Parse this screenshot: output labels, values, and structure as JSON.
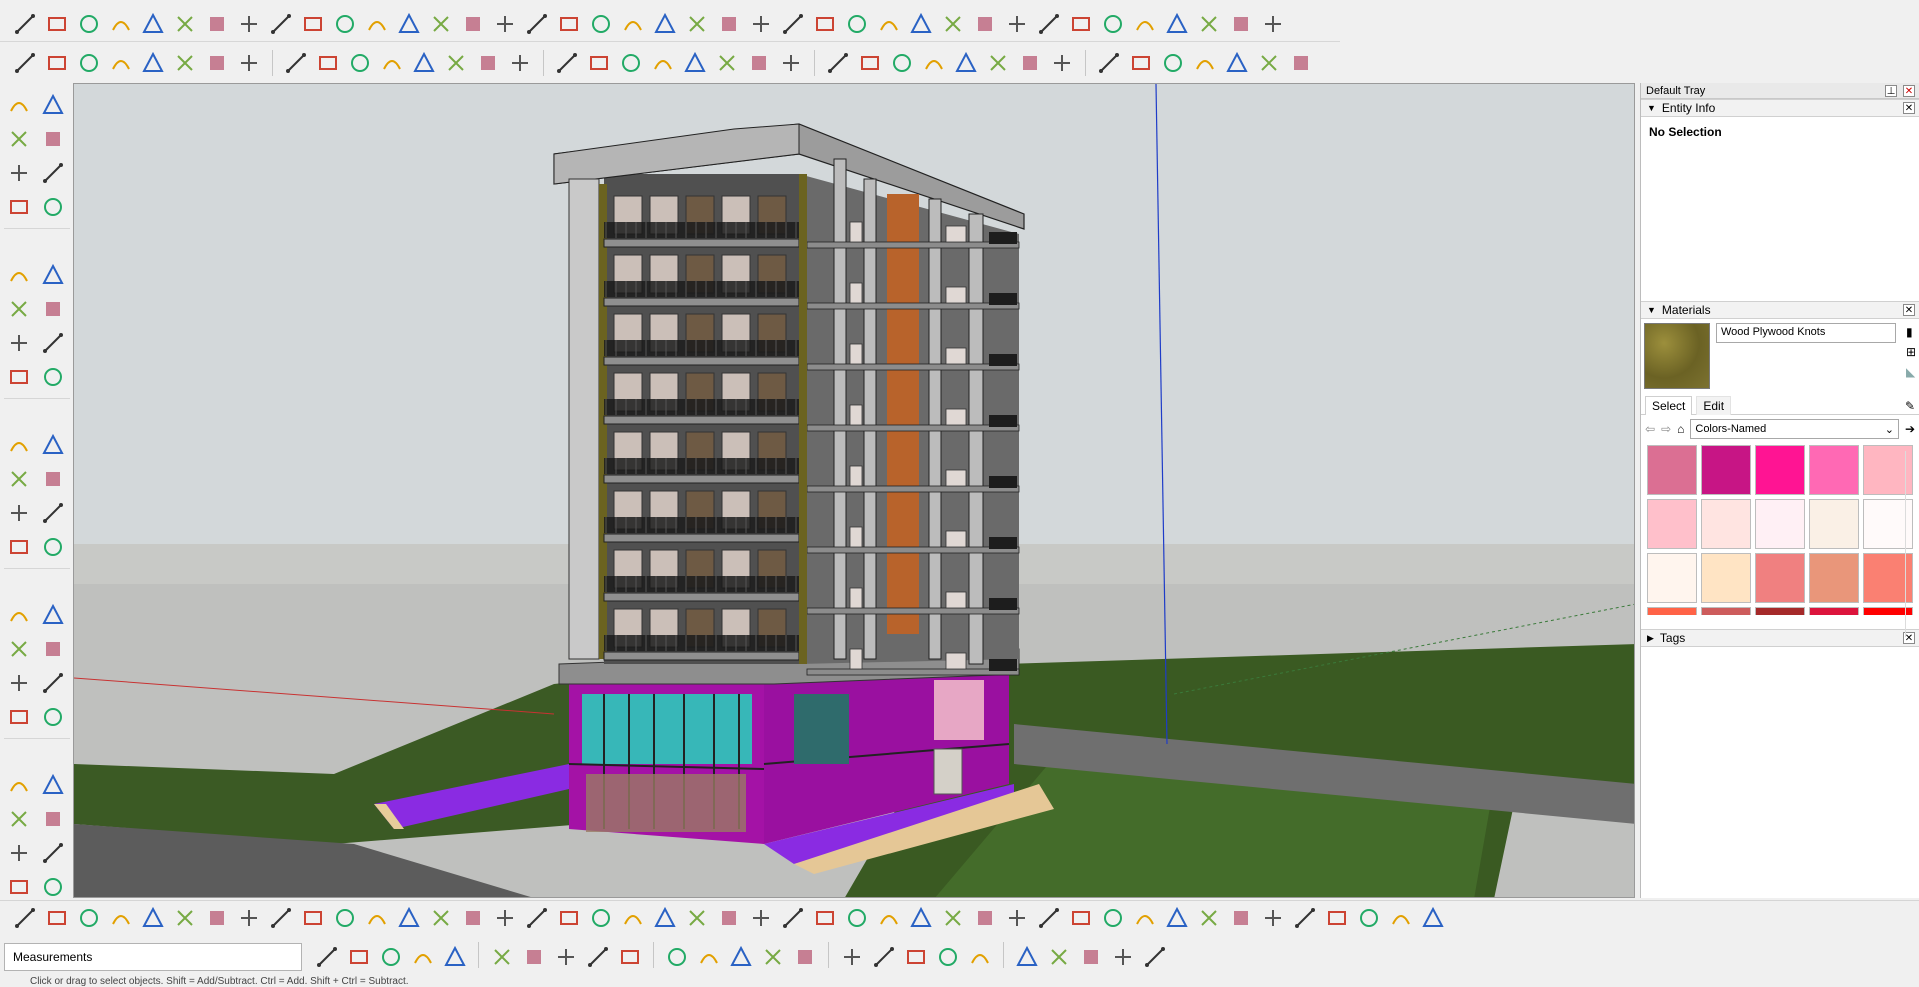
{
  "toolbar_top": {
    "icons": [
      "line-tool-icon",
      "arc-tool-icon",
      "paint-icon",
      "scissors-icon",
      "circle-tool-icon",
      "polygon-tool-icon",
      "sweep-icon",
      "extrude-icon",
      "sphere-icon",
      "lathe-icon",
      "bezier-icon",
      "fillet-icon",
      "chamfer-icon",
      "corner-icon",
      "offset-icon",
      "trim-icon",
      "stairs-icon",
      "railing-icon",
      "columns-icon",
      "grip-icon",
      "hand-icon",
      "leaf-icon",
      "fold-icon",
      "stacks-icon",
      "slope-icon",
      "truss-icon",
      "ramp-icon",
      "dome-icon",
      "pattern-icon",
      "pin-icon",
      "gate-icon",
      "window-grid-icon",
      "hatch-icon",
      "screen-icon",
      "fence-icon",
      "spiral-icon",
      "mesh-icon",
      "bevel-icon",
      "lattice-icon",
      "glass-icon"
    ]
  },
  "toolbar_second": {
    "icons": [
      "window-icon",
      "door-icon",
      "house-icon",
      "roof-icon",
      "garage-icon",
      "component-icon",
      "box-group-icon",
      "cube-icon",
      "stack-icon",
      "layer-stack-icon",
      "paste-icon",
      "door-frame-icon",
      "arch-window-icon",
      "ladder-icon",
      "blue-fill-icon",
      "diamond-icon",
      "roof-peak-icon",
      "hip-roof-icon",
      "flip-icon",
      "curve-icon",
      "angle-icon",
      "cross-icon",
      "fork-icon",
      "multi-line-icon",
      "tag-icon",
      "red-pencil-icon",
      "box-face-icon",
      "cylinder-icon",
      "hex-prism-icon",
      "round-solid-icon",
      "pentagon-solid-icon",
      "bend-icon",
      "red-sphere-icon",
      "yellow-cone-icon",
      "blue-cup-icon",
      "knot-icon",
      "red-arrow-icon",
      "eraser-icon",
      "hat-icon"
    ]
  },
  "left_tools": [
    "select-icon",
    "component-cube-icon",
    "paint-bucket-icon",
    "eraser-icon",
    "pencil-icon",
    "freehand-icon",
    "rectangle-icon",
    "rotated-rect-icon",
    "circle-icon",
    "polygon-icon",
    "arc-icon",
    "two-point-arc-icon",
    "three-point-arc-icon",
    "pie-icon",
    "move-icon",
    "push-pull-icon",
    "rotate-icon",
    "follow-me-icon",
    "scale-icon",
    "offset-icon",
    "tape-measure-icon",
    "dimension-icon",
    "protractor-icon",
    "text-icon",
    "axes-icon",
    "3d-text-icon",
    "orbit-icon",
    "pan-icon",
    "zoom-icon",
    "zoom-window-icon",
    "zoom-extents-icon",
    "previous-view-icon",
    "position-camera-icon",
    "look-around-icon",
    "walk-icon",
    "section-plane-icon",
    "sandbox-icon",
    "sandbox-scratch-icon",
    "sandbox-smoove-icon",
    "sandbox-stamp-icon"
  ],
  "tray": {
    "title": "Default Tray",
    "entity_info": {
      "title": "Entity Info",
      "status": "No Selection"
    },
    "materials": {
      "title": "Materials",
      "current_name": "Wood Plywood Knots",
      "tabs": [
        "Select",
        "Edit"
      ],
      "library": "Colors-Named",
      "swatches": [
        "#db6f93",
        "#c71585",
        "#ff1493",
        "#ff69b4",
        "#ffb6c1",
        "#ffc0cb",
        "#ffe4e1",
        "#fff0f5",
        "#faf0e6",
        "#fffafa",
        "#fff5ee",
        "#ffe4c4",
        "#f08080",
        "#e9967a",
        "#fa8072",
        "#ff6347",
        "#cd5c5c",
        "#a52a2a",
        "#dc143c",
        "#ff0000"
      ]
    },
    "tags": {
      "title": "Tags"
    }
  },
  "bottom_toolbar": {
    "icons": [
      "material-1-icon",
      "material-2-icon",
      "material-3-icon",
      "material-4-icon",
      "material-5-icon",
      "material-6-icon",
      "sync-icon",
      "camera-icon",
      "rotate-3d-icon",
      "orange-box-icon",
      "table-icon",
      "flag-icon",
      "cube-open-icon",
      "connector-icon",
      "bracket-icon",
      "node-line-icon",
      "node-curve-icon",
      "red-plus-icon",
      "green-plus-icon",
      "blue-cross-icon",
      "grid-dots-icon",
      "cone-icon",
      "cone-star-icon",
      "warning-icon",
      "spiral-icon",
      "bulb-icon",
      "hook-icon",
      "snap-icon",
      "box-tool-icon",
      "magnet-icon",
      "puzzle-icon",
      "gear-cube-icon",
      "split-icon",
      "rotate-cube-icon",
      "red-badge-icon",
      "cube-star-icon",
      "frame-icon",
      "grid-frame-icon",
      "frame-blue-icon",
      "amber-grid-icon",
      "yellow-grid-icon",
      "amber-tile-icon",
      "red-x-icon",
      "arc-dots-icon",
      "layout-icon"
    ]
  },
  "measurements": {
    "label": "Measurements",
    "tools": [
      "extents-icon",
      "snap-x-icon",
      "close-x-icon",
      "line-points-icon",
      "line-node-icon",
      "box-select-icon",
      "pen-line-icon",
      "crop-icon",
      "box-plain-icon",
      "grid-box-icon",
      "arrow-icon",
      "cursor-icon",
      "move-icon",
      "refresh-icon",
      "maximize-icon",
      "help-icon",
      "orbit-icon",
      "pan-hand-icon",
      "zoom-icon",
      "zoom-window-icon",
      "extents-zoom-icon",
      "zoom-prev-icon",
      "camera-person-icon",
      "eye-icon",
      "walk-icon"
    ]
  },
  "status": {
    "text": "Click or drag to select objects. Shift = Add/Subtract. Ctrl = Add. Shift + Ctrl = Subtract."
  },
  "colors": {
    "sky": "#d2d8da",
    "ground_gray": "#c6c6c4",
    "grass": "#3a5a23",
    "magenta": "#a312a6",
    "teal": "#36b8b7",
    "axis_blue": "#1e3cc8",
    "axis_red": "#c83232"
  }
}
